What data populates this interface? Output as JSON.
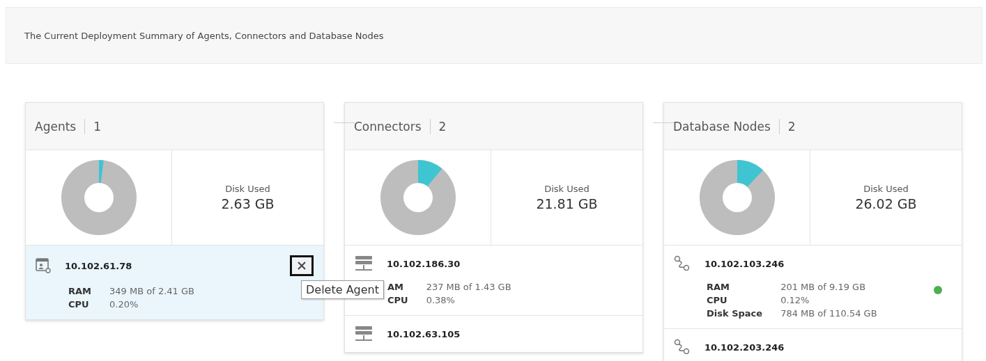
{
  "summary": {
    "title": "The Current Deployment Summary of Agents, Connectors and Database Nodes"
  },
  "panels": [
    {
      "kind": "agent",
      "title": "Agents",
      "count": "1",
      "disk_label": "Disk Used",
      "disk_value": "2.63 GB",
      "rows": [
        {
          "ip": "10.102.61.78",
          "selected": true,
          "delete_button": true,
          "metrics": [
            {
              "label": "RAM",
              "value": "349 MB of 2.41 GB"
            },
            {
              "label": "CPU",
              "value": "0.20%"
            }
          ]
        }
      ]
    },
    {
      "kind": "connector",
      "title": "Connectors",
      "count": "2",
      "disk_label": "Disk Used",
      "disk_value": "21.81 GB",
      "rows": [
        {
          "ip": "10.102.186.30",
          "selected": false,
          "delete_button": false,
          "metrics": [
            {
              "label": "AM",
              "value": "237 MB of 1.43 GB"
            },
            {
              "label": "CPU",
              "value": "0.38%"
            }
          ]
        },
        {
          "ip": "10.102.63.105",
          "selected": false,
          "delete_button": false,
          "metrics": []
        }
      ]
    },
    {
      "kind": "database",
      "title": "Database Nodes",
      "count": "2",
      "disk_label": "Disk Used",
      "disk_value": "26.02 GB",
      "rows": [
        {
          "ip": "10.102.103.246",
          "selected": false,
          "delete_button": false,
          "color": "#4caf50",
          "metrics": [
            {
              "label": "RAM",
              "value": "201 MB of 9.19 GB"
            },
            {
              "label": "CPU",
              "value": "0.12%"
            },
            {
              "label": "Disk Space",
              "value": "784 MB of 110.54 GB"
            }
          ]
        },
        {
          "ip": "10.102.203.246",
          "selected": false,
          "delete_button": false,
          "metrics": []
        }
      ]
    }
  ],
  "tooltip": {
    "text": "Delete Agent"
  }
}
